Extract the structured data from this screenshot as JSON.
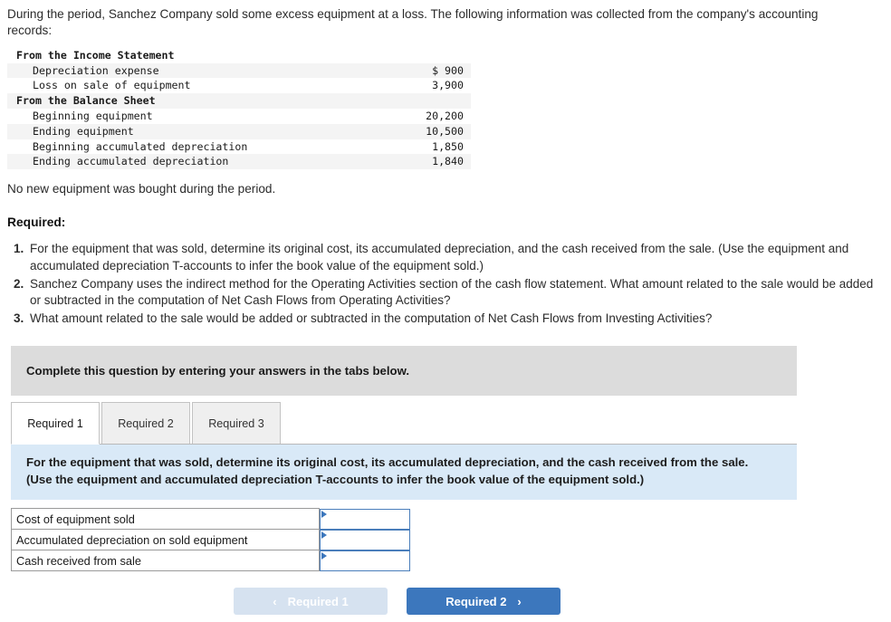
{
  "intro": {
    "text": "During the period, Sanchez Company sold some excess equipment at a loss. The following information was collected from the company's accounting records:"
  },
  "financials": {
    "rows": [
      {
        "label": "From the Income Statement",
        "amount": "",
        "type": "header",
        "shaded": false
      },
      {
        "label": "Depreciation expense",
        "amount": "$ 900",
        "type": "item",
        "shaded": true
      },
      {
        "label": "Loss on sale of equipment",
        "amount": "3,900",
        "type": "item",
        "shaded": false
      },
      {
        "label": "From the Balance Sheet",
        "amount": "",
        "type": "header",
        "shaded": true
      },
      {
        "label": "Beginning equipment",
        "amount": "20,200",
        "type": "item",
        "shaded": false
      },
      {
        "label": "Ending equipment",
        "amount": "10,500",
        "type": "item",
        "shaded": true
      },
      {
        "label": "Beginning accumulated depreciation",
        "amount": "1,850",
        "type": "item",
        "shaded": false
      },
      {
        "label": "Ending accumulated depreciation",
        "amount": "1,840",
        "type": "item",
        "shaded": true
      }
    ]
  },
  "note": {
    "text": "No new equipment was bought during the period."
  },
  "required": {
    "heading": "Required:",
    "items": [
      "For the equipment that was sold, determine its original cost, its accumulated depreciation, and the cash received from the sale. (Use the equipment and accumulated depreciation T-accounts to infer the book value of the equipment sold.)",
      "Sanchez Company uses the indirect method for the Operating Activities section of the cash flow statement. What amount related to the sale would be added or subtracted in the computation of Net Cash Flows from Operating Activities?",
      "What amount related to the sale would be added or subtracted in the computation of Net Cash Flows from Investing Activities?"
    ]
  },
  "banner": {
    "text": "Complete this question by entering your answers in the tabs below."
  },
  "tabs": [
    {
      "label": "Required 1",
      "active": true
    },
    {
      "label": "Required 2",
      "active": false
    },
    {
      "label": "Required 3",
      "active": false
    }
  ],
  "question_panel": {
    "text": "For the equipment that was sold, determine its original cost, its accumulated depreciation, and the cash received from the sale. (Use the equipment and accumulated depreciation T-accounts to infer the book value of the equipment sold.)"
  },
  "answer_table": {
    "rows": [
      {
        "label": "Cost of equipment sold",
        "value": ""
      },
      {
        "label": "Accumulated depreciation on sold equipment",
        "value": ""
      },
      {
        "label": "Cash received from sale",
        "value": ""
      }
    ]
  },
  "nav": {
    "prev_label": "Required 1",
    "prev_chevron": "‹",
    "next_label": "Required 2",
    "next_chevron": "›"
  },
  "colors": {
    "banner_gray": "#dcdcdc",
    "panel_blue": "#d9e9f7",
    "accent_blue": "#3c77bd",
    "disabled_blue": "#d6e2f0",
    "input_border": "#4a7ebb"
  }
}
